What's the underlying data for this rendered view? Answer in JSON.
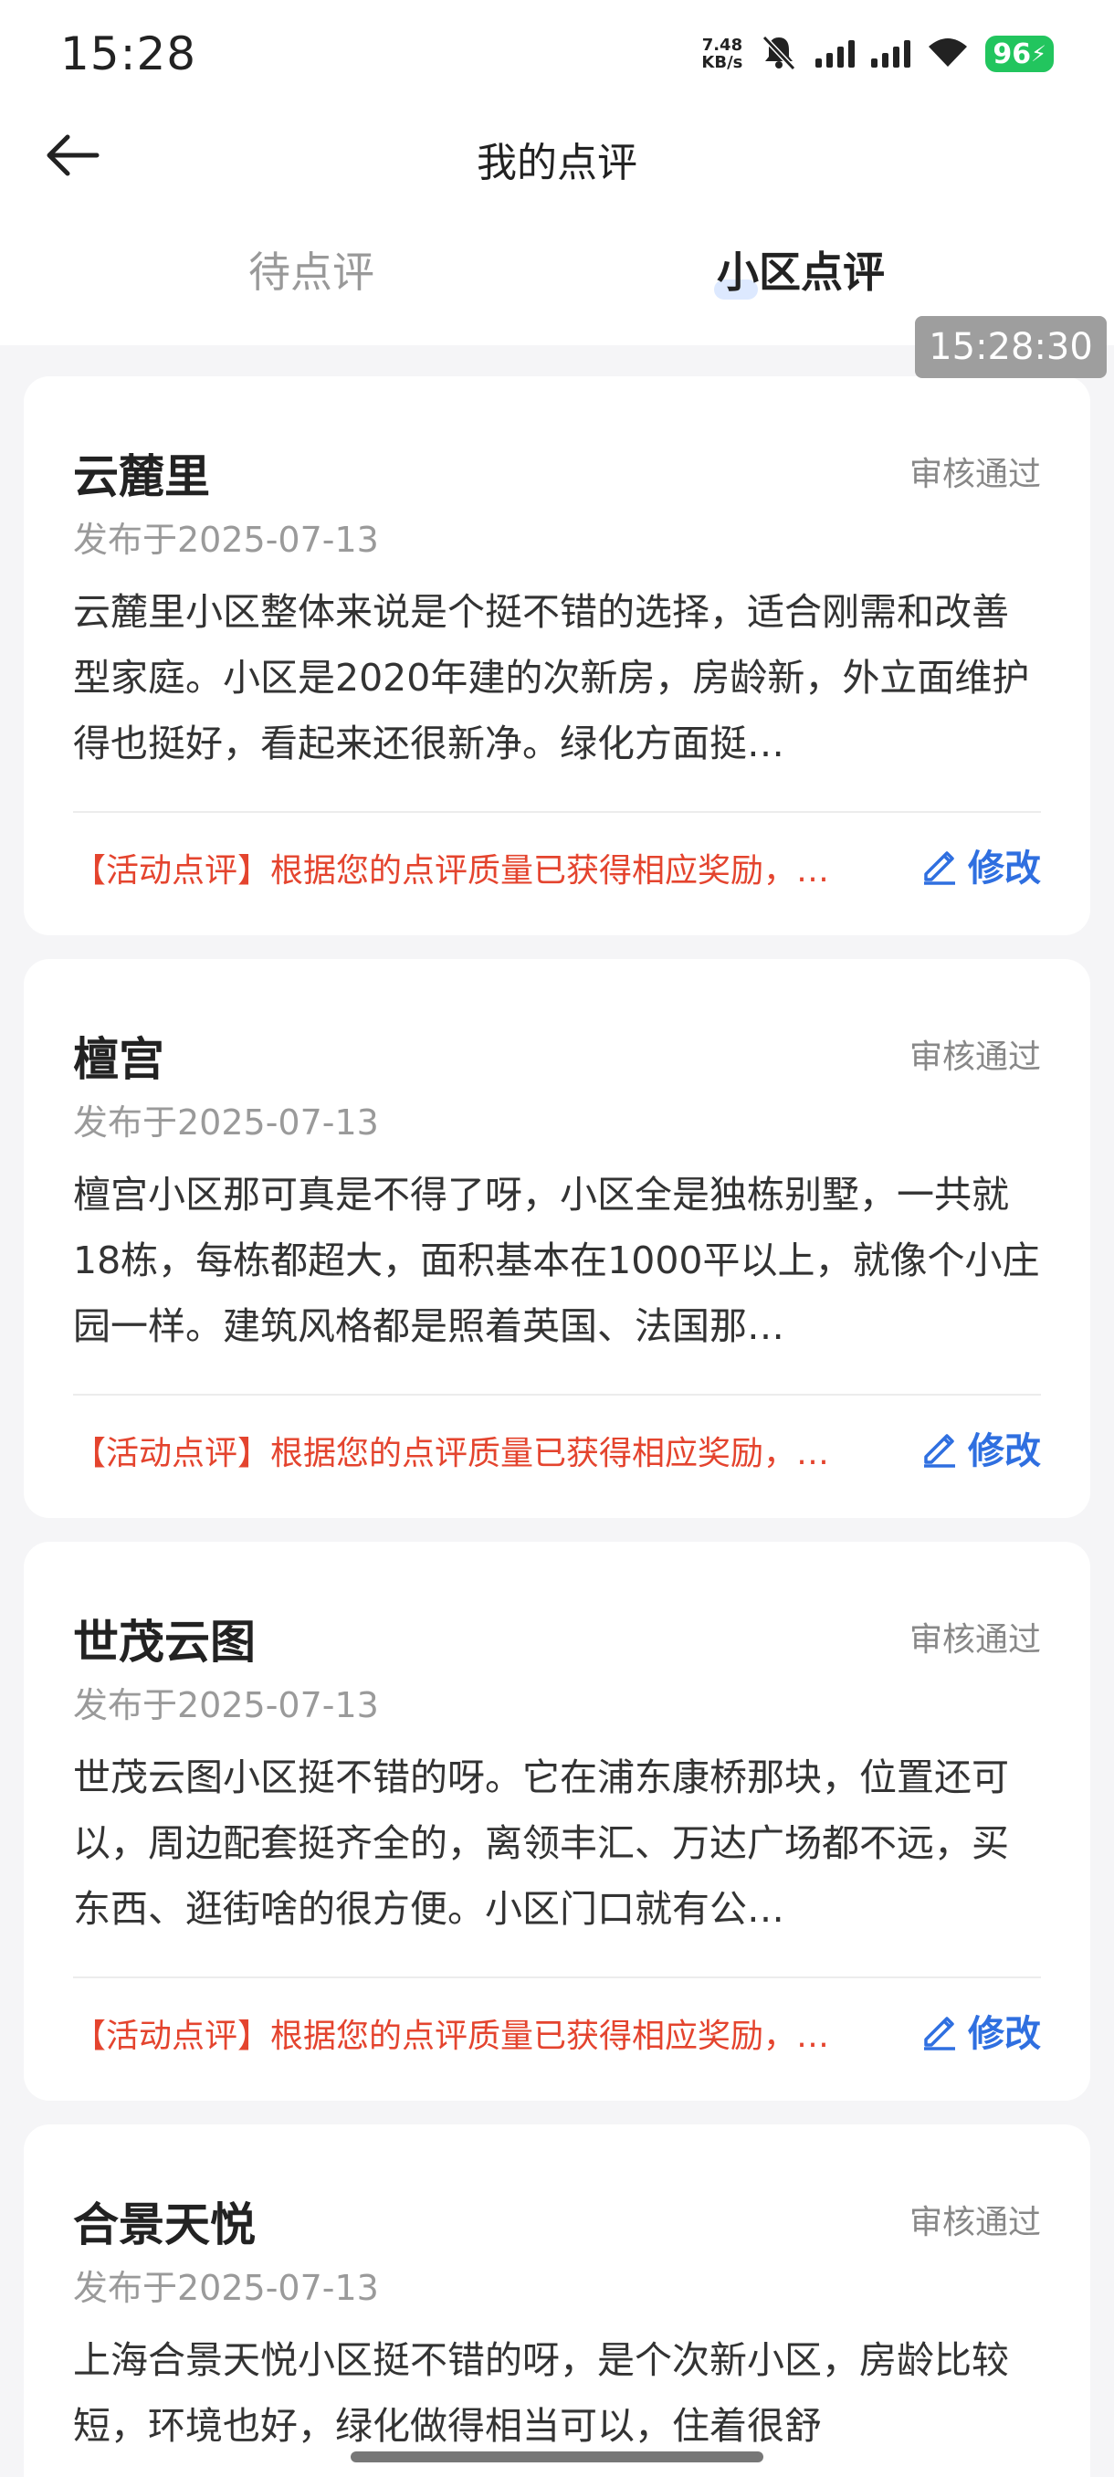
{
  "status_bar": {
    "time": "15:28",
    "net_speed_value": "7.48",
    "net_speed_unit": "KB/s",
    "battery": "96"
  },
  "nav": {
    "title": "我的点评"
  },
  "tabs": [
    {
      "label": "待点评"
    },
    {
      "label": "小区点评"
    }
  ],
  "time_badge": "15:28:30",
  "edit_label": "修改",
  "reviews": [
    {
      "title": "云麓里",
      "status": "审核通过",
      "date": "发布于2025-07-13",
      "body": "云麓里小区整体来说是个挺不错的选择，适合刚需和改善型家庭。小区是2020年建的次新房，房龄新，外立面维护得也挺好，看起来还很新净。绿化方面挺…",
      "reward": "【活动点评】根据您的点评质量已获得相应奖励，…"
    },
    {
      "title": "檀宫",
      "status": "审核通过",
      "date": "发布于2025-07-13",
      "body": "檀宫小区那可真是不得了呀，小区全是独栋别墅，一共就18栋，每栋都超大，面积基本在1000平以上，就像个小庄园一样。建筑风格都是照着英国、法国那…",
      "reward": "【活动点评】根据您的点评质量已获得相应奖励，…"
    },
    {
      "title": "世茂云图",
      "status": "审核通过",
      "date": "发布于2025-07-13",
      "body": "世茂云图小区挺不错的呀。它在浦东康桥那块，位置还可以，周边配套挺齐全的，离领丰汇、万达广场都不远，买东西、逛街啥的很方便。小区门口就有公…",
      "reward": "【活动点评】根据您的点评质量已获得相应奖励，…"
    },
    {
      "title": "合景天悦",
      "status": "审核通过",
      "date": "发布于2025-07-13",
      "body": "上海合景天悦小区挺不错的呀，是个次新小区，房龄比较短，环境也好，绿化做得相当可以，住着很舒",
      "reward": ""
    }
  ]
}
